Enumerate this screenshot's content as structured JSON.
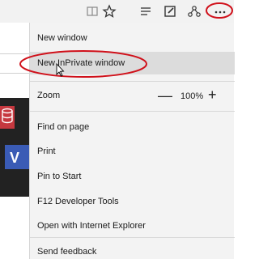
{
  "toolbar": {
    "icons": [
      "reading-view-icon",
      "favorites-star-icon",
      "hub-icon",
      "web-note-icon",
      "share-icon",
      "more-actions-icon"
    ]
  },
  "menu": {
    "new_window": "New window",
    "new_inprivate_window": "New InPrivate window",
    "zoom_label": "Zoom",
    "zoom_minus": "—",
    "zoom_value": "100%",
    "zoom_plus": "+",
    "find_on_page": "Find on page",
    "print": "Print",
    "pin_to_start": "Pin to Start",
    "developer_tools": "F12 Developer Tools",
    "open_with_ie": "Open with Internet Explorer",
    "send_feedback": "Send feedback"
  },
  "colors": {
    "menu_bg": "#f3f3f3",
    "highlight": "#dcdcdc",
    "annotation_red": "#d0101a"
  }
}
